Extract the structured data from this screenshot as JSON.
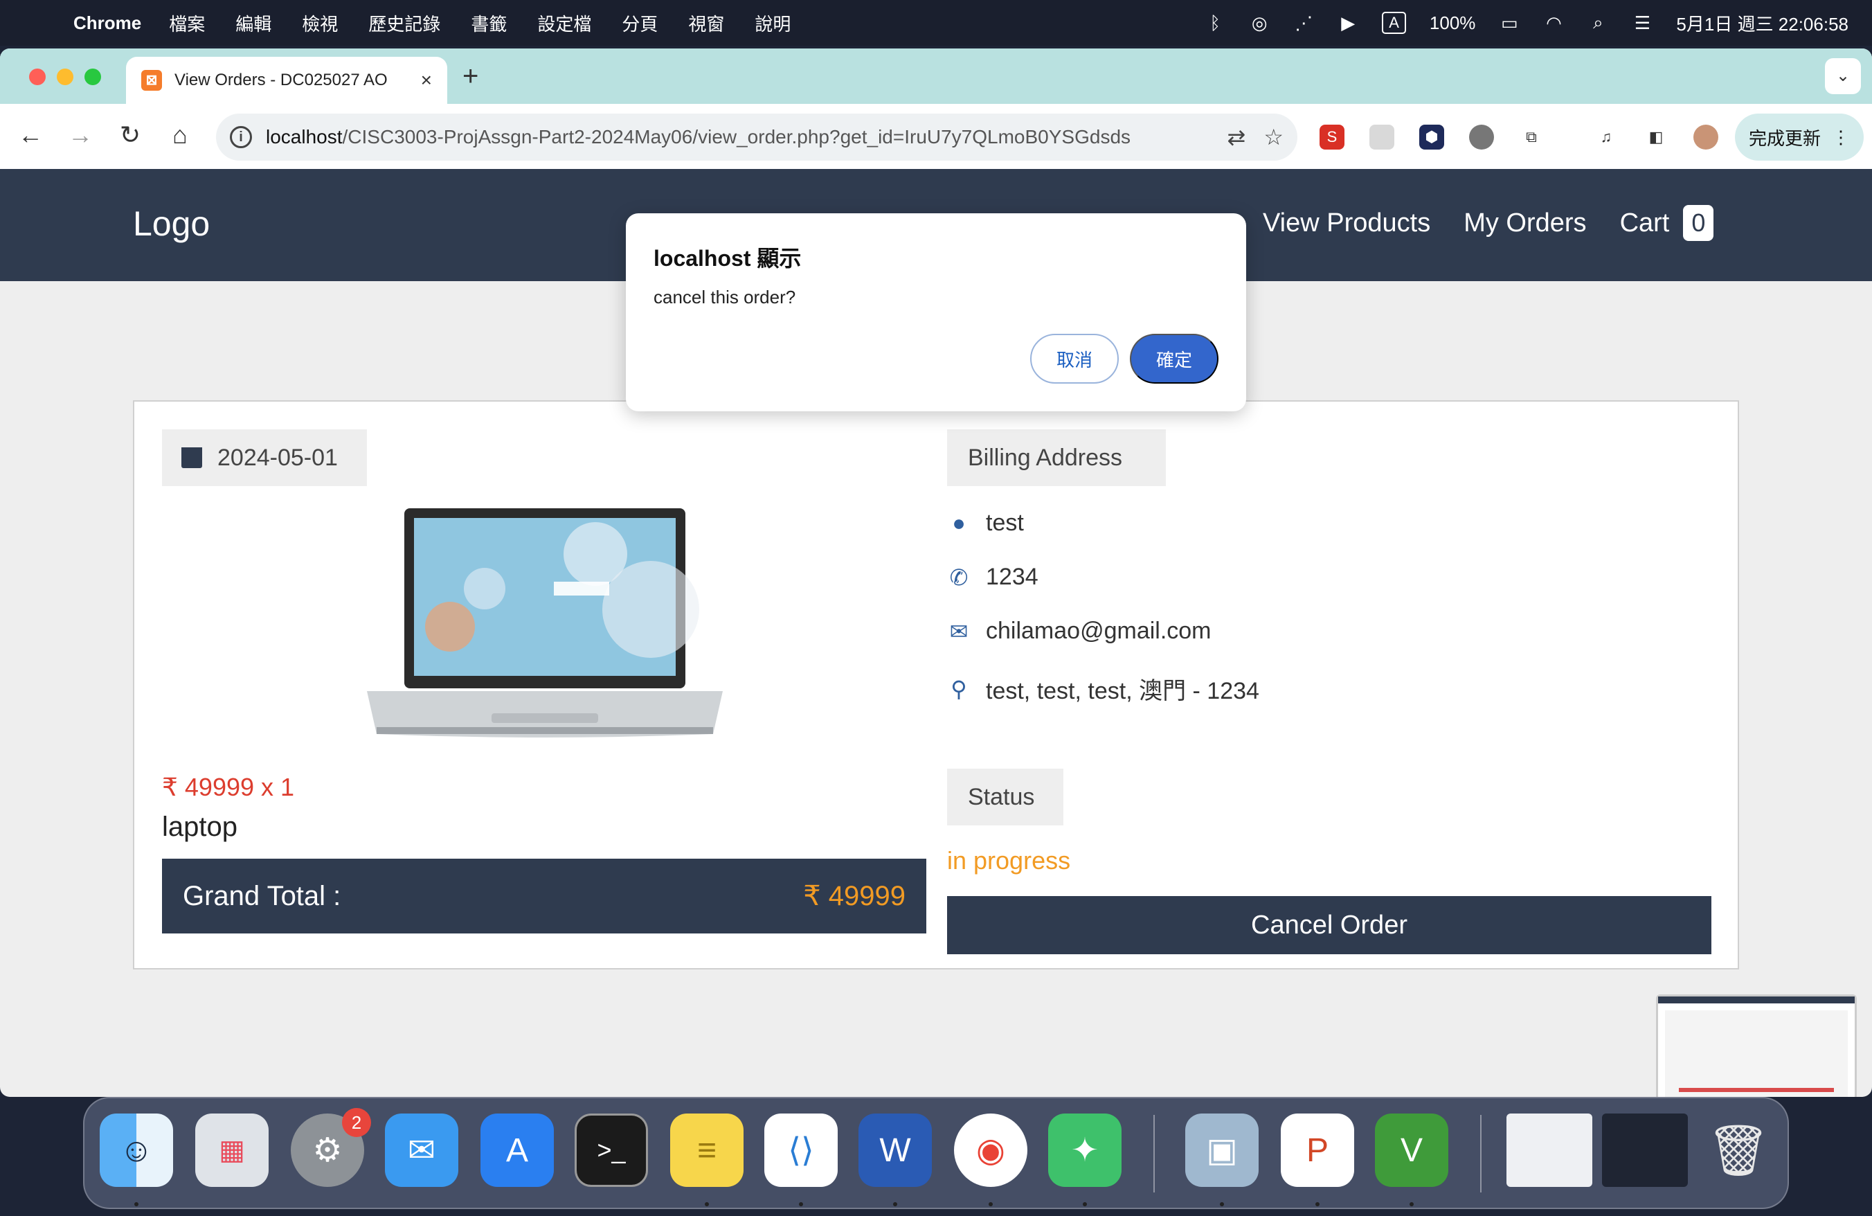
{
  "menubar": {
    "app_name": "Chrome",
    "menus": [
      "檔案",
      "編輯",
      "檢視",
      "歷史記錄",
      "書籤",
      "設定檔",
      "分頁",
      "視窗",
      "說明"
    ],
    "input_method": "A",
    "battery": "100%",
    "datetime": "5月1日 週三 22:06:58"
  },
  "browser": {
    "tab_title": "View Orders - DC025027 AO",
    "url_host": "localhost",
    "url_path": "/CISC3003-ProjAssgn-Part2-2024May06/view_order.php?get_id=IruU7y7QLmoB0YSGdsds",
    "update_label": "完成更新"
  },
  "site": {
    "logo": "Logo",
    "nav": [
      "View Products",
      "My Orders",
      "Cart"
    ],
    "cart_count": "0"
  },
  "order": {
    "date": "2024-05-01",
    "price_line": "₹ 49999 x 1",
    "product_name": "laptop",
    "grand_total_label": "Grand Total :",
    "grand_total_value": "₹ 49999",
    "billing_label": "Billing Address",
    "name": "test",
    "phone": "1234",
    "email": "chilamao@gmail.com",
    "address": "test, test, test, 澳門 - 1234",
    "status_label": "Status",
    "status_value": "in progress",
    "cancel_button": "Cancel Order"
  },
  "dialog": {
    "title": "localhost 顯示",
    "message": "cancel this order?",
    "cancel": "取消",
    "ok": "確定"
  },
  "dock": {
    "settings_badge": "2",
    "apps": [
      "finder",
      "launchpad",
      "system-settings",
      "mail",
      "app-store",
      "terminal",
      "notes",
      "vscode",
      "word",
      "chrome",
      "wechat",
      "preview",
      "powerpoint",
      "vim",
      "trash"
    ]
  },
  "colors": {
    "header_bg": "#2f3b4f",
    "price": "#dc3d2e",
    "accent_orange": "#f29b24",
    "dialog_ok": "#3366cc",
    "tabbar": "#b9e1e0"
  }
}
